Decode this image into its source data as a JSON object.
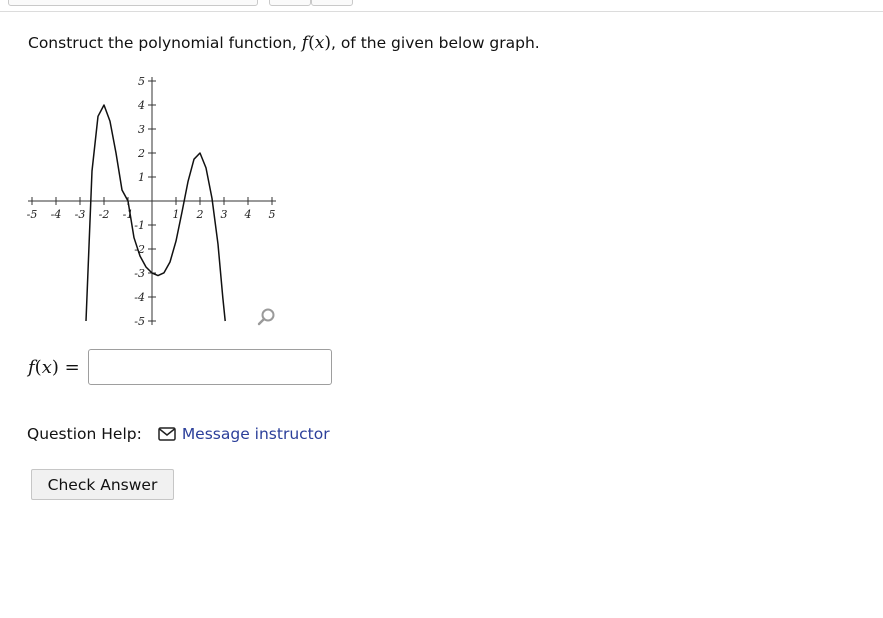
{
  "question": {
    "prefix": "Construct the polynomial function,",
    "function_symbol": "f",
    "variable": "x",
    "suffix": ", of the given below graph."
  },
  "chart_data": {
    "type": "line",
    "title": "",
    "xlabel": "",
    "ylabel": "",
    "xlim": [
      -5,
      5
    ],
    "ylim": [
      -5,
      5
    ],
    "x_tick_labels": [
      "-5",
      "-4",
      "-3",
      "-2",
      "-1",
      "1",
      "2",
      "3",
      "4",
      "5"
    ],
    "y_tick_labels": [
      "5",
      "4",
      "3",
      "2",
      "1",
      "-1",
      "-2",
      "-3",
      "-4",
      "-5"
    ],
    "grid": false,
    "series": [
      {
        "x_intercepts": [
          -3,
          -1,
          2,
          3
        ],
        "y_intercept": -3,
        "points": [
          [
            -2.75,
            -5
          ],
          [
            -2.5,
            1.25
          ],
          [
            -2.25,
            3.53
          ],
          [
            -2.0,
            4.0
          ],
          [
            -1.75,
            3.32
          ],
          [
            -1.5,
            2.0
          ],
          [
            -1.25,
            0.46
          ],
          [
            -1.0,
            0.0
          ],
          [
            -0.75,
            -1.53
          ],
          [
            -0.5,
            -2.29
          ],
          [
            -0.25,
            -2.75
          ],
          [
            0.0,
            -3.0
          ],
          [
            0.25,
            -3.11
          ],
          [
            0.5,
            -2.99
          ],
          [
            0.75,
            -2.54
          ],
          [
            1.0,
            -1.67
          ],
          [
            1.25,
            -0.46
          ],
          [
            1.5,
            0.81
          ],
          [
            1.75,
            1.74
          ],
          [
            2.0,
            2.0
          ],
          [
            2.25,
            1.38
          ],
          [
            2.5,
            0.11
          ],
          [
            2.75,
            -1.8
          ],
          [
            2.95,
            -4.02
          ],
          [
            3.05,
            -5
          ]
        ]
      }
    ],
    "color": "#111111"
  },
  "answer": {
    "label_function": "f",
    "label_variable": "x",
    "value": "",
    "placeholder": ""
  },
  "help": {
    "label": "Question Help:",
    "link_label": "Message instructor",
    "link_color": "#2b3f9a",
    "icon": "envelope-icon"
  },
  "check_button": {
    "label": "Check Answer"
  },
  "toolbar_icons": {
    "graph_zoom": "magnifier-icon"
  }
}
